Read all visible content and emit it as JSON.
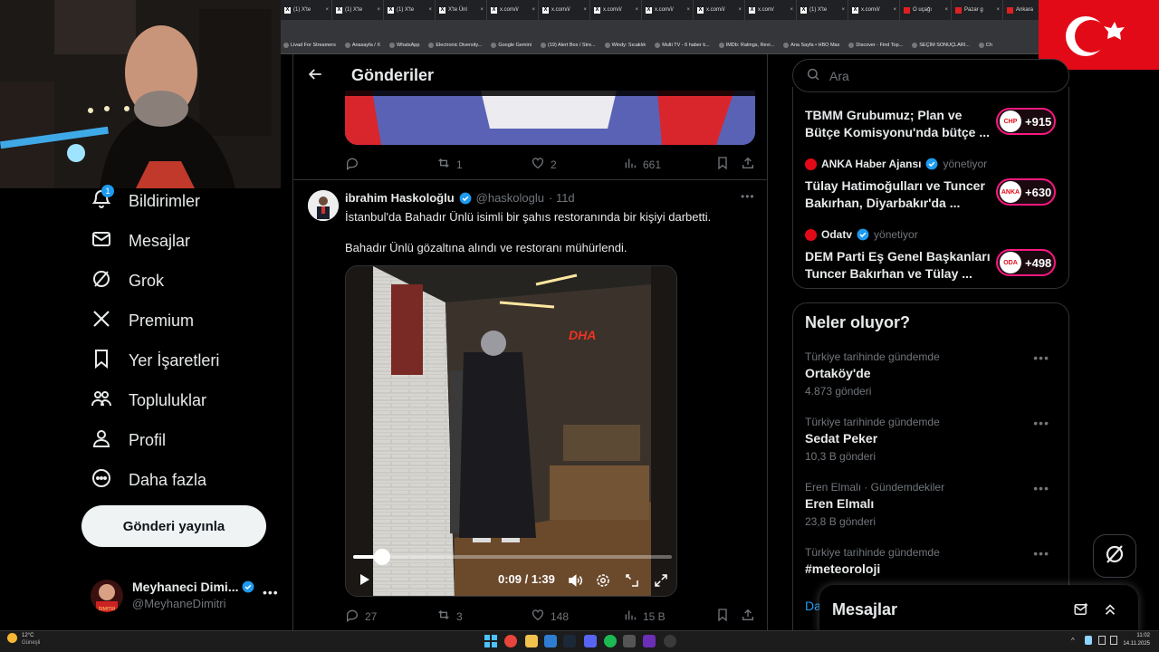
{
  "tabs": [
    {
      "label": "(1) X'te",
      "icon": "x-icon"
    },
    {
      "label": "(1) X'te",
      "icon": "x-icon"
    },
    {
      "label": "(1) X'te",
      "icon": "x-icon"
    },
    {
      "label": "X'te Ünl",
      "icon": "x-icon"
    },
    {
      "label": "x.com/i/",
      "icon": "x-icon"
    },
    {
      "label": "x.com/i/",
      "icon": "x-icon"
    },
    {
      "label": "x.com/i/",
      "icon": "x-icon"
    },
    {
      "label": "x.com/i/",
      "icon": "x-icon"
    },
    {
      "label": "x.com/i/",
      "icon": "x-icon"
    },
    {
      "label": "x.com/",
      "icon": "x-icon"
    },
    {
      "label": "(1) X'te",
      "icon": "x-icon"
    },
    {
      "label": "x.com/i/",
      "icon": "x-icon"
    },
    {
      "label": "O uçağı",
      "icon": "news-icon"
    },
    {
      "label": "Pazar g",
      "icon": "news-icon"
    },
    {
      "label": "Ankara",
      "icon": "news-icon"
    }
  ],
  "bookmarks": [
    "Livad For Streamers",
    "Anasayfa / X",
    "WhatsApp",
    "Electronic Diversity...",
    "Google Gemini",
    "(19) Alert Box / Stre...",
    "Windy: Sıcaklık",
    "Multi TV - 6 haber k...",
    "IMDb: Ratings, Revi...",
    "Ana Sayfa • HBO Max",
    "Discover - Find Top...",
    "SEÇİM SONUÇLARI...",
    "Ch"
  ],
  "nav": {
    "notifications": "Bildirimler",
    "notifications_badge": "1",
    "messages": "Mesajlar",
    "grok": "Grok",
    "premium": "Premium",
    "bookmarks": "Yer İşaretleri",
    "communities": "Topluluklar",
    "profile": "Profil",
    "more": "Daha fazla",
    "post_button": "Gönderi yayınla"
  },
  "account": {
    "name": "Meyhaneci Dimi...",
    "handle": "@MeyhaneDimitri"
  },
  "header": {
    "title": "Gönderiler"
  },
  "post1_actions": {
    "replies": "",
    "reposts": "1",
    "likes": "2",
    "views": "661"
  },
  "post2": {
    "author": "ibrahim Haskoloğlu",
    "handle": "@haskologlu",
    "time": "· 11d",
    "text1": "İstanbul'da Bahadır Ünlü isimli bir şahıs restoranında bir kişiyi darbetti.",
    "text2": "Bahadır Ünlü gözaltına alındı ve restoranı mühürlendi.",
    "video_watermark": "DHA",
    "video_time": "0:09 / 1:39",
    "video_progress": 0.09,
    "actions": {
      "replies": "27",
      "reposts": "3",
      "likes": "148",
      "views": "15 B"
    }
  },
  "search": {
    "placeholder": "Ara"
  },
  "ads": [
    {
      "org": "",
      "title1": "TBMM Grubumuz; Plan ve",
      "title2": "Bütçe Komisyonu'nda bütçe ...",
      "count": "+915",
      "logo": "CHP"
    },
    {
      "org": "ANKA Haber Ajansı",
      "managed": "yönetiyor",
      "title1": "Tülay Hatimoğulları ve Tuncer",
      "title2": "Bakırhan, Diyarbakır'da ...",
      "count": "+630",
      "logo": "ANKA"
    },
    {
      "org": "Odatv",
      "managed": "yönetiyor",
      "title1": "DEM Parti Eş Genel Başkanları",
      "title2": "Tuncer Bakırhan ve Tülay ...",
      "count": "+498",
      "logo": "ODA"
    }
  ],
  "trends_title": "Neler oluyor?",
  "trends": [
    {
      "category": "Türkiye tarihinde gündemde",
      "name": "Ortaköy'de",
      "count": "4.873 gönderi"
    },
    {
      "category": "Türkiye tarihinde gündemde",
      "name": "Sedat Peker",
      "count": "10,3 B gönderi"
    },
    {
      "category": "Eren Elmalı · Gündemdekiler",
      "name": "Eren Elmalı",
      "count": "23,8 B gönderi"
    },
    {
      "category": "Türkiye tarihinde gündemde",
      "name": "#meteoroloji",
      "count": ""
    }
  ],
  "trends_more": "Da",
  "drawer": {
    "title": "Mesajlar"
  },
  "taskbar": {
    "weather_temp": "12°C",
    "weather_desc": "Güneşli",
    "time": "11:02",
    "date": "14.11.2025"
  },
  "colors": {
    "accent": "#1d9bf0",
    "pink": "#f91880",
    "flag_red": "#e30a17"
  }
}
